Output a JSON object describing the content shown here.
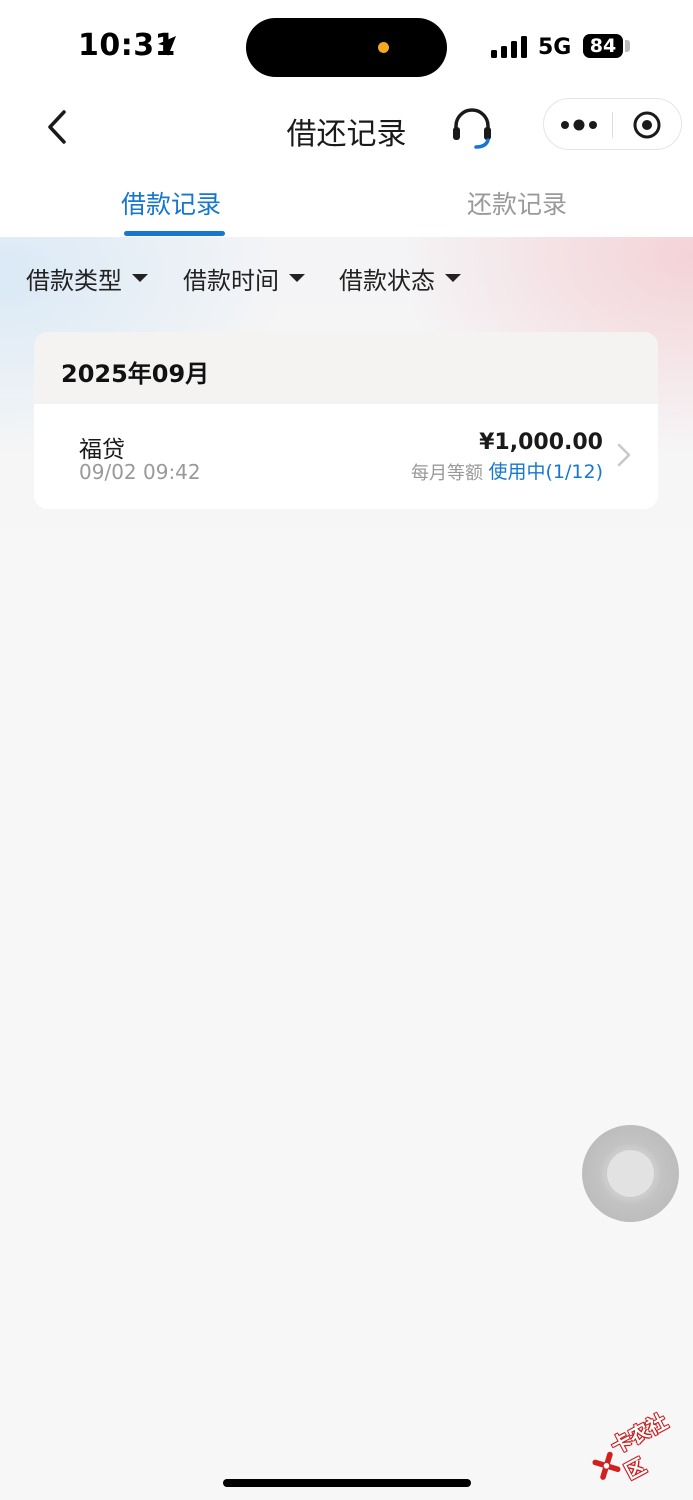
{
  "status_bar": {
    "time": "10:31",
    "network": "5G",
    "battery": "84",
    "icons": [
      "location-arrow-icon",
      "signal-bars-icon",
      "battery-icon"
    ]
  },
  "nav": {
    "title": "借还记录",
    "icons": [
      "back-chevron-icon",
      "headset-icon",
      "more-dots-icon",
      "target-circle-icon"
    ]
  },
  "tabs": [
    {
      "label": "借款记录",
      "active": true
    },
    {
      "label": "还款记录",
      "active": false
    }
  ],
  "filters": [
    "借款类型",
    "借款时间",
    "借款状态"
  ],
  "records": {
    "month": "2025年09月",
    "items": [
      {
        "name": "福贷",
        "time": "09/02 09:42",
        "amount": "¥1,000.00",
        "method": "每月等额",
        "status": "使用中(1/12)"
      }
    ]
  },
  "watermark": {
    "text": "卡农社区"
  },
  "colors": {
    "accent": "#1677d2",
    "muted_text": "#999999",
    "background": "#f7f7f7"
  }
}
